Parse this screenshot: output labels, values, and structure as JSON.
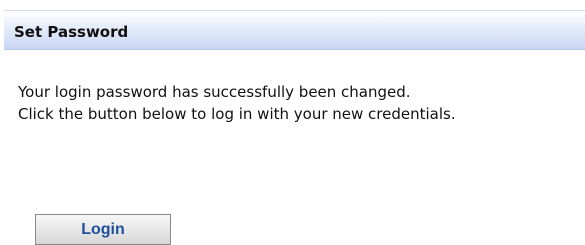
{
  "panel": {
    "title": "Set Password"
  },
  "message": {
    "line1": "Your login password has successfully been changed.",
    "line2": "Click the button below to log in with your new credentials."
  },
  "actions": {
    "login_label": "Login"
  },
  "colors": {
    "header_gradient_top": "#ffffff",
    "header_gradient_bottom": "#c9d7f3",
    "button_text": "#1f4f9a",
    "text": "#111111"
  }
}
